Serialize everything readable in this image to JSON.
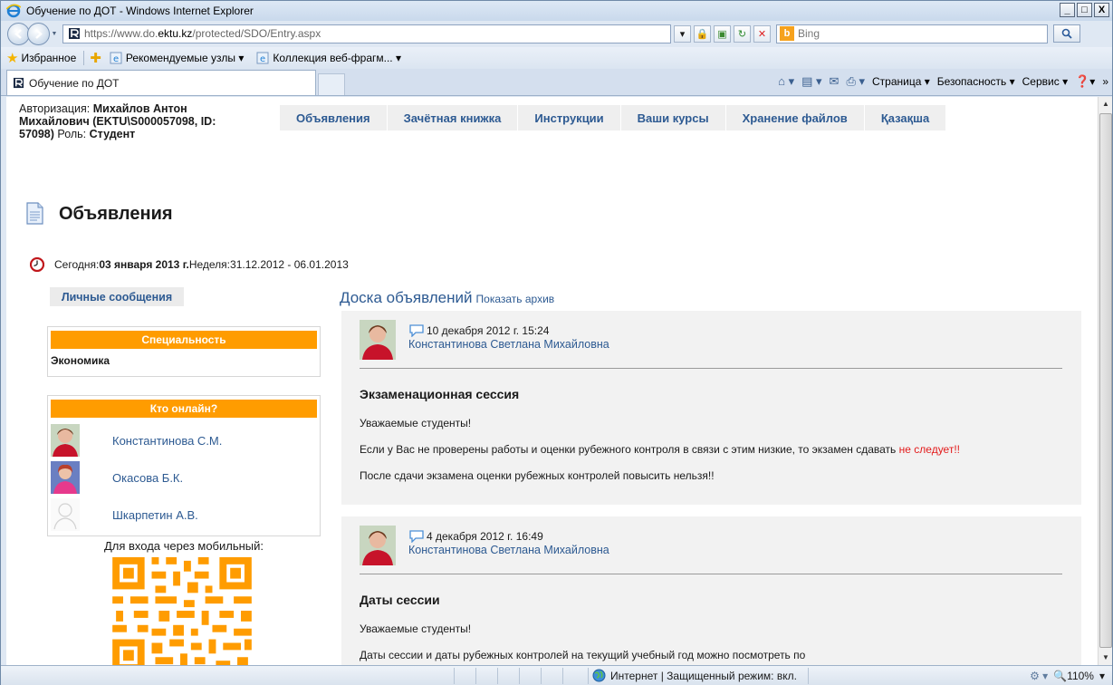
{
  "window": {
    "title": "Обучение по ДОТ - Windows Internet Explorer",
    "controls": [
      "_",
      "□",
      "X"
    ]
  },
  "address": {
    "url_prefix": "https://www.do.",
    "url_domain": "ektu.kz",
    "url_suffix": "/protected/SDO/Entry.aspx",
    "search_placeholder": "Bing"
  },
  "favorites_bar": {
    "favorites_label": "Избранное",
    "items": [
      "Рекомендуемые узлы ▾",
      "Коллекция веб-фрагм... ▾"
    ]
  },
  "tab": {
    "title": "Обучение по ДОТ"
  },
  "command_bar": {
    "page": "Страница ▾",
    "safety": "Безопасность ▾",
    "tools": "Сервис ▾",
    "help": "▾",
    "more": "»"
  },
  "page": {
    "auth": {
      "prefix": "Авторизация: ",
      "user": "Михайлов Антон Михайлович (EKTU\\S000057098, ID: 57098)",
      "role_label": " Роль: ",
      "role": "Студент"
    },
    "nav": [
      "Объявления",
      "Зачётная книжка",
      "Инструкции",
      "Ваши курсы",
      "Хранение файлов",
      "Қазақша"
    ],
    "heading": "Объявления",
    "today": {
      "label": "Сегодня: ",
      "date": "03 января 2013 г.",
      "week_label": " Неделя: ",
      "week": "31.12.2012 - 06.01.2013"
    },
    "sidebar": {
      "personal_messages": "Личные сообщения",
      "speciality_header": "Специальность",
      "speciality": "Экономика",
      "online_header": "Кто онлайн?",
      "online_users": [
        "Константинова С.М.",
        "Окасова Б.К.",
        "Шкарпетин А.В."
      ],
      "mobile_label": "Для входа через мобильный:"
    },
    "board": {
      "title": "Доска объявлений",
      "archive_link": "Показать архив",
      "posts": [
        {
          "date": "10 декабря 2012 г. 15:24",
          "author": "Константинова Светлана Михайловна",
          "title": "Экзаменационная сессия",
          "greeting": "Уважаемые студенты!",
          "line1_pre": "Если у Вас не проверены работы и оценки рубежного контроля в связи с этим низкие, то экзамен сдавать ",
          "line1_warn": "не следует!!",
          "line2": "После сдачи экзамена оценки рубежных контролей повысить нельзя!!"
        },
        {
          "date": "4 декабря 2012 г. 16:49",
          "author": "Константинова Светлана Михайловна",
          "title": "Даты сессии",
          "greeting": "Уважаемые студенты!",
          "line1": "Даты сессии и даты рубежных контролей на текущий учебный год можно посмотреть по"
        }
      ]
    }
  },
  "status_bar": {
    "zone": "Интернет | Защищенный режим: вкл.",
    "zoom": "110%"
  },
  "colors": {
    "accent_orange": "#ff9c00",
    "link_blue": "#2d5a92",
    "warning_red": "#e31b1b"
  }
}
